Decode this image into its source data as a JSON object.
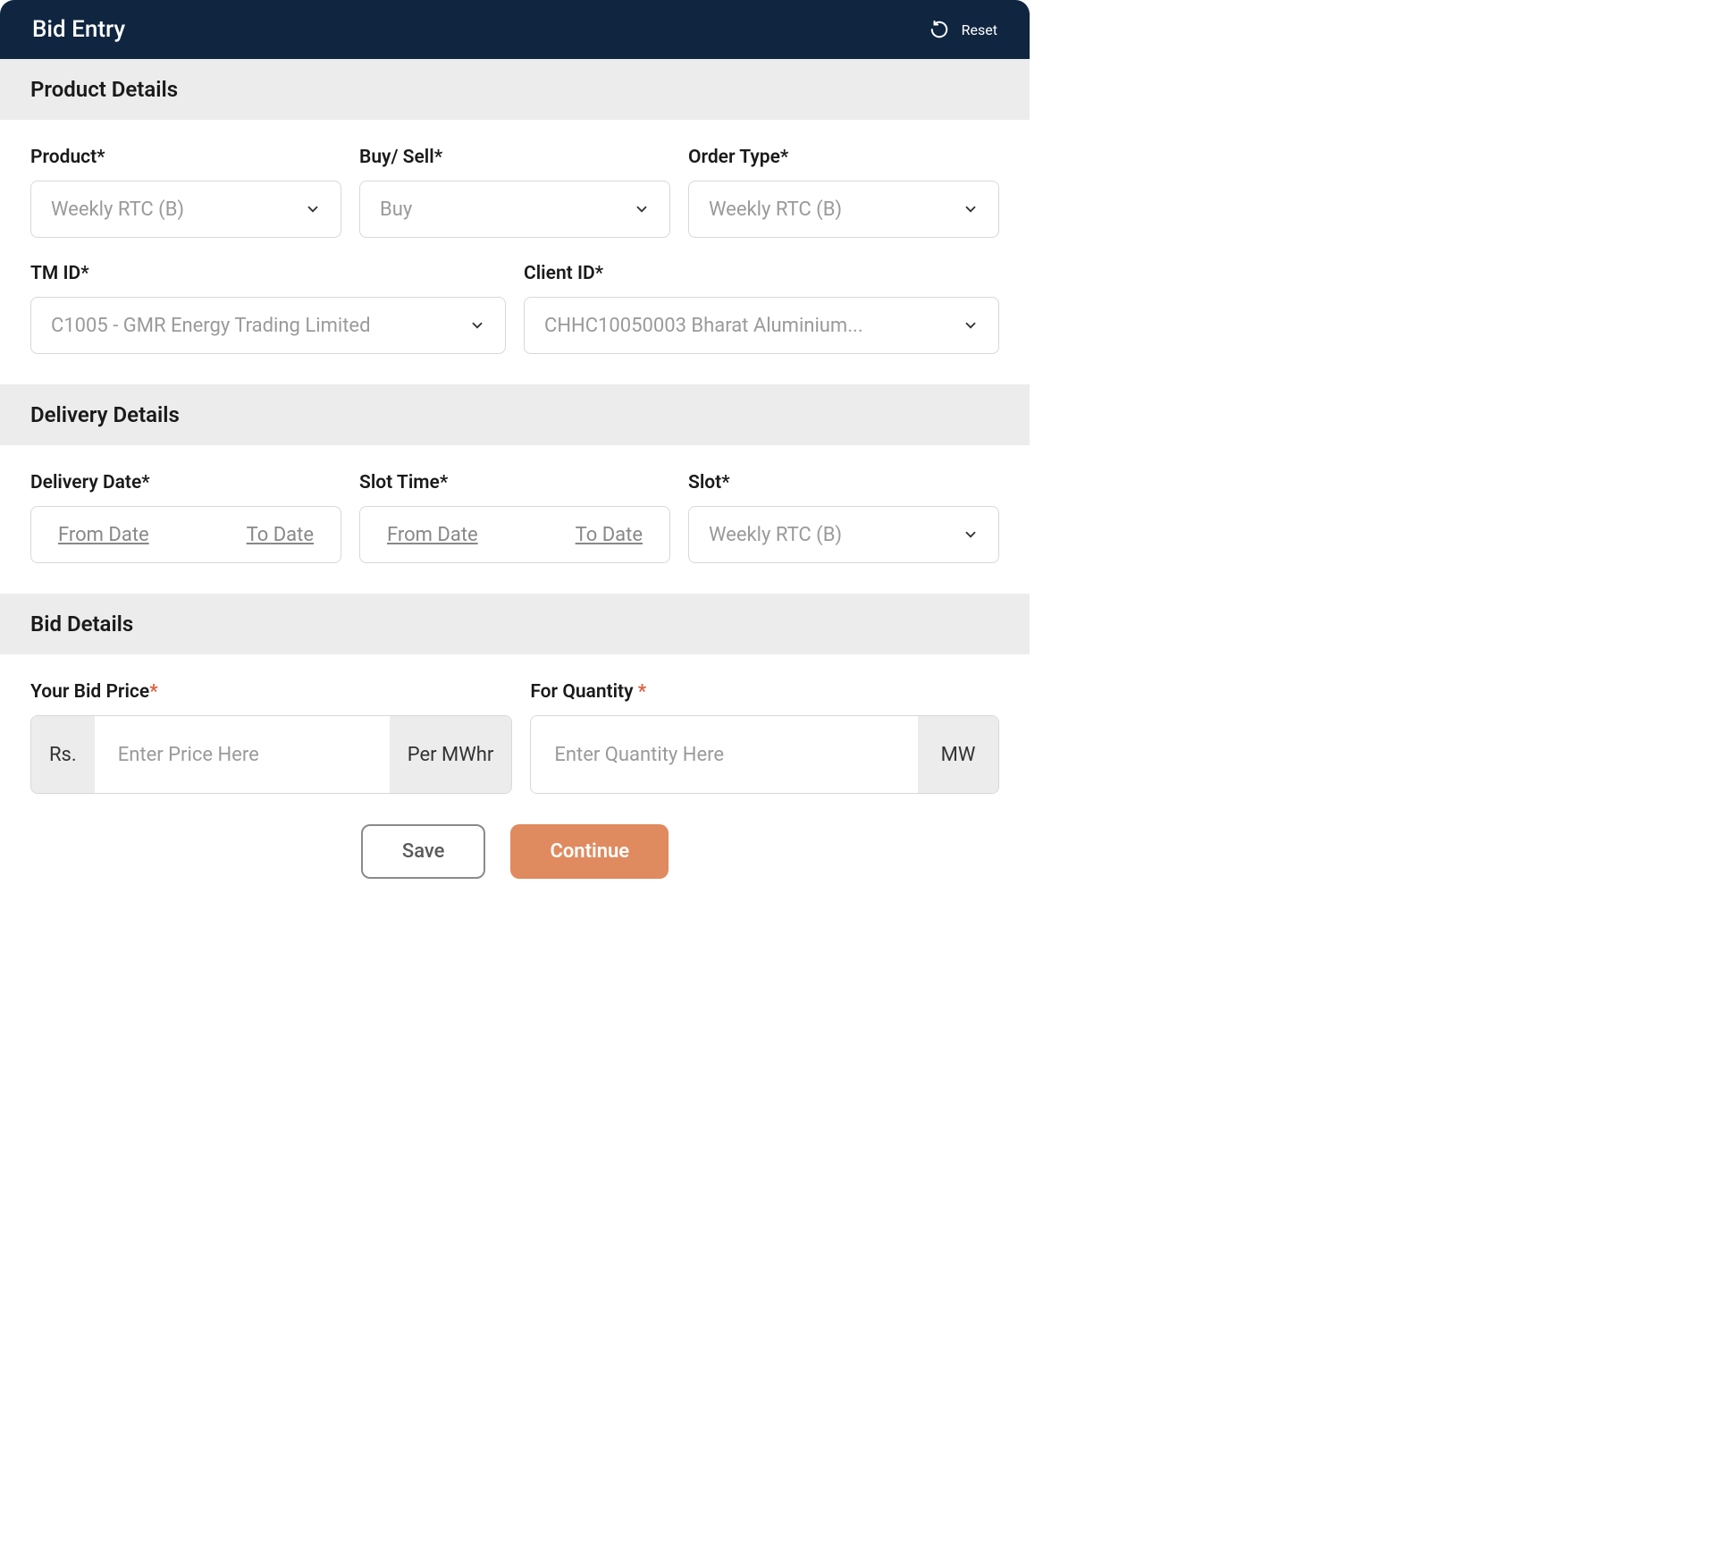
{
  "header": {
    "title": "Bid Entry",
    "reset_label": "Reset"
  },
  "sections": {
    "product": {
      "title": "Product Details"
    },
    "delivery": {
      "title": "Delivery Details"
    },
    "bid": {
      "title": "Bid Details"
    }
  },
  "fields": {
    "product": {
      "label": "Product*",
      "value": "Weekly RTC (B)"
    },
    "buy_sell": {
      "label": "Buy/ Sell*",
      "value": "Buy"
    },
    "order_type": {
      "label": "Order Type*",
      "value": "Weekly RTC (B)"
    },
    "tm_id": {
      "label": "TM ID*",
      "value": "C1005 - GMR Energy Trading Limited"
    },
    "client_id": {
      "label": "Client ID*",
      "value": "CHHC10050003 Bharat Aluminium..."
    },
    "delivery_date": {
      "label": "Delivery Date*",
      "from": "From Date",
      "to": "To Date"
    },
    "slot_time": {
      "label": "Slot Time*",
      "from": "From Date",
      "to": "To Date"
    },
    "slot": {
      "label": "Slot*",
      "value": "Weekly RTC (B)"
    },
    "bid_price": {
      "label": "Your Bid Price",
      "asterisk": "*",
      "prefix": "Rs.",
      "placeholder": "Enter Price Here",
      "suffix": "Per MWhr"
    },
    "quantity": {
      "label": "For Quantity ",
      "asterisk": "*",
      "placeholder": "Enter Quantity Here",
      "suffix": "MW"
    }
  },
  "buttons": {
    "save": "Save",
    "continue": "Continue"
  }
}
